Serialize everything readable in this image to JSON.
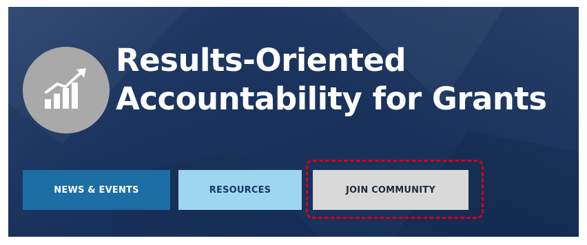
{
  "banner": {
    "title_line1": "Results-Oriented",
    "title_line2": "Accountability for Grants",
    "logo_icon": "growth-chart-icon",
    "background_color": "#1a335c"
  },
  "nav": {
    "buttons": [
      {
        "label": "NEWS & EVENTS",
        "color": "#1c6ea4",
        "text_color": "#ffffff"
      },
      {
        "label": "RESOURCES",
        "color": "#9ed6f0",
        "text_color": "#14365f"
      },
      {
        "label": "JOIN COMMUNITY",
        "color": "#d9d9d9",
        "text_color": "#1f2a36"
      }
    ]
  },
  "annotation": {
    "highlight_color": "#d0021b",
    "highlight_style": "dashed",
    "highlighted_item": "JOIN COMMUNITY"
  }
}
